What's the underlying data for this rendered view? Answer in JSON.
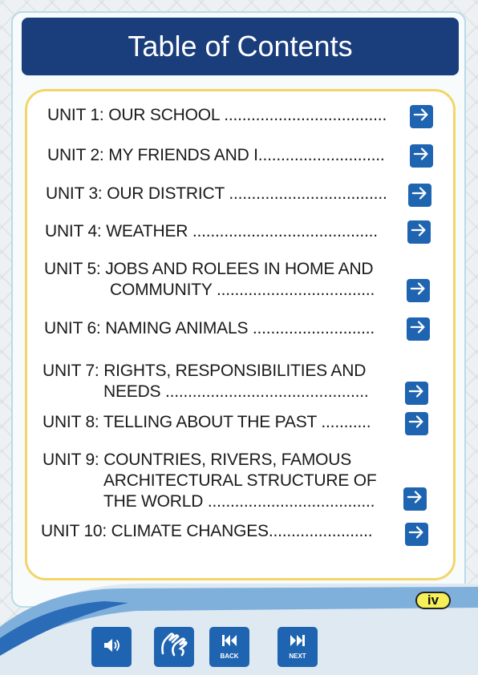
{
  "header": {
    "title": "Table of Contents"
  },
  "toc": [
    {
      "lines": [
        "UNIT 1: OUR SCHOOL ...................................."
      ]
    },
    {
      "lines": [
        "UNIT 2: MY FRIENDS AND I............................"
      ]
    },
    {
      "lines": [
        "UNIT 3: OUR DISTRICT ..................................."
      ]
    },
    {
      "lines": [
        "UNIT 4: WEATHER ........................................."
      ]
    },
    {
      "lines": [
        "UNIT 5: JOBS AND ROLEES IN HOME AND",
        "COMMUNITY ..................................."
      ]
    },
    {
      "lines": [
        "UNIT 6: NAMING ANIMALS ..........................."
      ]
    },
    {
      "lines": [
        "UNIT 7: RIGHTS, RESPONSIBILITIES AND",
        "NEEDS ............................................."
      ]
    },
    {
      "lines": [
        "UNIT 8: TELLING ABOUT THE PAST ..........."
      ]
    },
    {
      "lines": [
        "UNIT 9: COUNTRIES, RIVERS, FAMOUS",
        "ARCHITECTURAL STRUCTURE OF",
        "THE WORLD ....................................."
      ]
    },
    {
      "lines": [
        "UNIT 10: CLIMATE CHANGES......................."
      ]
    }
  ],
  "page_number": "iv",
  "nav": {
    "back_label": "BACK",
    "next_label": "NEXT"
  },
  "colors": {
    "header": "#1a3d7c",
    "button": "#1f64b0",
    "toc_border": "#f3d56a",
    "page_badge": "#f6ef5a"
  },
  "icons": [
    "arrow-right-icon",
    "speaker-icon",
    "sign-language-icon",
    "skip-back-icon",
    "skip-next-icon"
  ]
}
